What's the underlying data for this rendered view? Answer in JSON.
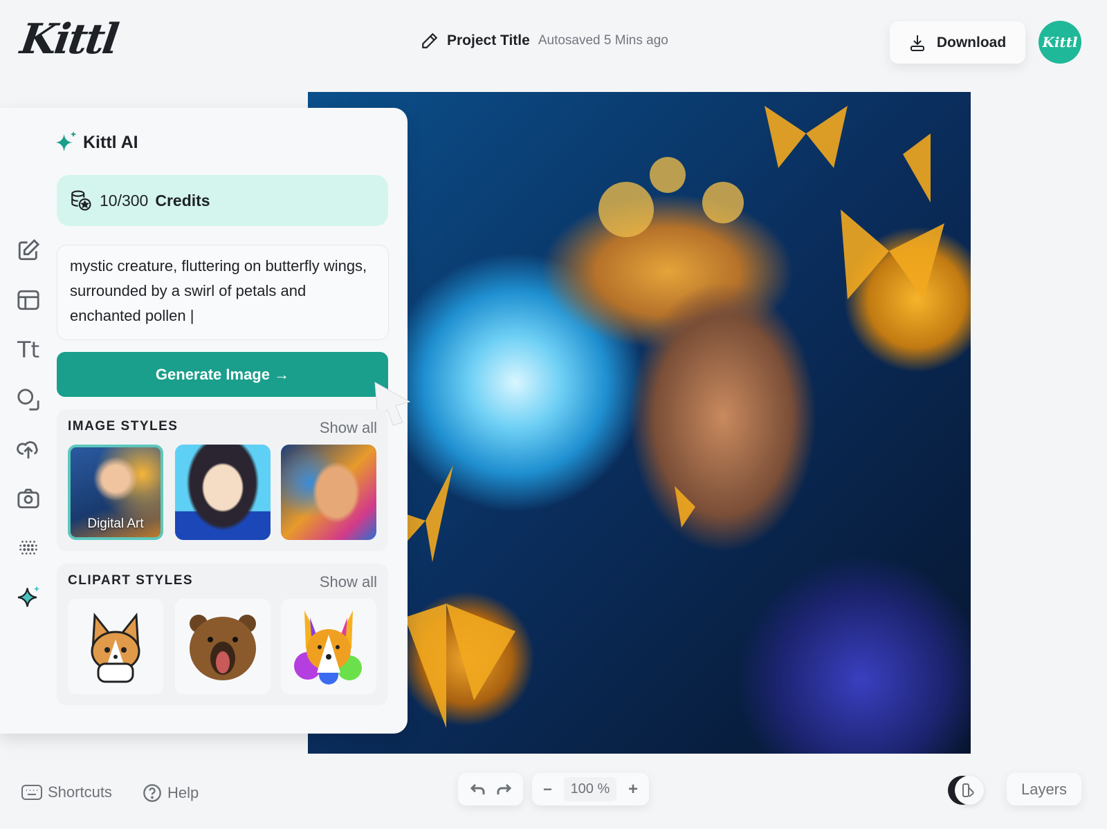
{
  "header": {
    "logo": "Kittl",
    "project_title": "Project Title",
    "autosave_status": "Autosaved 5 Mins ago",
    "download_label": "Download",
    "avatar_text": "Kittl"
  },
  "sidebar": {
    "items": [
      "edit",
      "templates",
      "text",
      "shapes",
      "upload",
      "photos",
      "patterns",
      "kittl-ai"
    ]
  },
  "panel": {
    "title": "Kittl AI",
    "credits_used": "10/300",
    "credits_label": "Credits",
    "prompt_value": "mystic creature, fluttering on butterfly wings, surrounded by a swirl of petals and enchanted pollen |",
    "generate_label": "Generate Image →",
    "image_styles": {
      "heading": "IMAGE STYLES",
      "show_all": "Show all",
      "items": [
        {
          "label": "Digital Art",
          "selected": true
        },
        {
          "label": ""
        },
        {
          "label": ""
        }
      ]
    },
    "clipart_styles": {
      "heading": "CLIPART STYLES",
      "show_all": "Show all"
    }
  },
  "footer": {
    "shortcuts": "Shortcuts",
    "help": "Help",
    "zoom": "100 %",
    "zoom_out": "−",
    "zoom_in": "+",
    "layers": "Layers"
  },
  "colors": {
    "accent": "#1a9f8c",
    "credits_bg": "#d4f5ee",
    "avatar": "#1fb898"
  }
}
